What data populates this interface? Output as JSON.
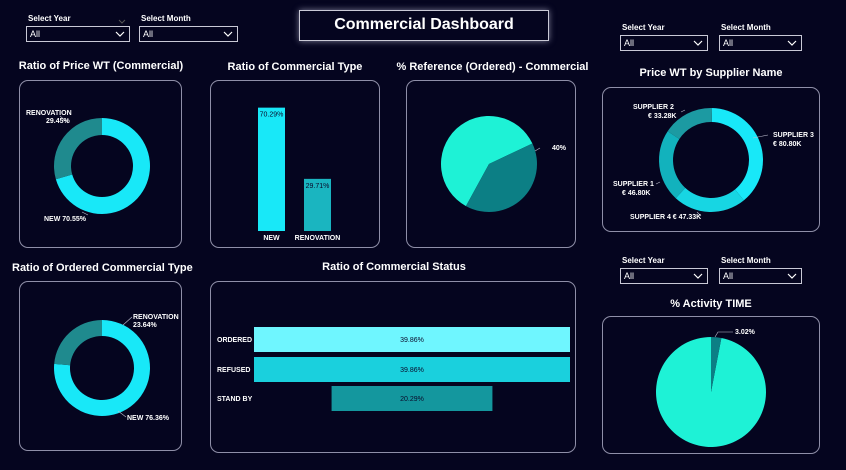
{
  "dashboard_title": "Commercial Dashboard",
  "colors": {
    "background": "#05051f",
    "cyan": "#18e8f8",
    "teal": "#1f8a8e",
    "mint": "#1ef2d6",
    "dark_teal": "#0c7f85"
  },
  "filters": [
    {
      "year_label": "Select Year",
      "year_value": "All",
      "month_label": "Select Month",
      "month_value": "All"
    },
    {
      "year_label": "Select Year",
      "year_value": "All",
      "month_label": "Select Month",
      "month_value": "All"
    },
    {
      "year_label": "Select Year",
      "year_value": "All",
      "month_label": "Select Month",
      "month_value": "All"
    }
  ],
  "chart_data": [
    {
      "type": "pie",
      "title": "Ratio of Price WT (Commercial)",
      "donut": true,
      "slices": [
        {
          "label": "NEW",
          "value": 70.55,
          "display": "NEW 70.55%"
        },
        {
          "label": "RENOVATION",
          "value": 29.45,
          "display": "29.45%"
        }
      ]
    },
    {
      "type": "bar",
      "title": "Ratio of Commercial Type",
      "categories": [
        "NEW",
        "RENOVATION"
      ],
      "values": [
        70.29,
        29.71
      ],
      "labels": [
        "70.29%",
        "29.71%"
      ]
    },
    {
      "type": "pie",
      "title": "% Reference (Ordered) - Commercial",
      "slices": [
        {
          "label": "",
          "value": 60,
          "display": ""
        },
        {
          "label": "",
          "value": 40,
          "display": "40%"
        }
      ]
    },
    {
      "type": "pie",
      "title": "Price WT by Supplier Name",
      "donut": true,
      "slices": [
        {
          "label": "SUPPLIER 3",
          "value": 80.8,
          "display": "€ 80.80K"
        },
        {
          "label": "SUPPLIER 4",
          "value": 47.33,
          "display": "€ 47.33K"
        },
        {
          "label": "SUPPLIER 1",
          "value": 46.8,
          "display": "€ 46.80K"
        },
        {
          "label": "SUPPLIER 2",
          "value": 33.28,
          "display": "€ 33.28K"
        }
      ]
    },
    {
      "type": "pie",
      "title": "Ratio of Ordered Commercial Type",
      "donut": true,
      "slices": [
        {
          "label": "NEW",
          "value": 76.36,
          "display": "NEW 76.36%"
        },
        {
          "label": "RENOVATION",
          "value": 23.64,
          "display": "23.64%"
        }
      ]
    },
    {
      "type": "bar",
      "title": "Ratio of Commercial Status",
      "orientation": "horizontal",
      "categories": [
        "ORDERED",
        "REFUSED",
        "STAND BY"
      ],
      "values": [
        39.86,
        39.86,
        20.29
      ],
      "labels": [
        "39.86%",
        "39.86%",
        "20.29%"
      ]
    },
    {
      "type": "pie",
      "title": "% Activity TIME",
      "slices": [
        {
          "label": "",
          "value": 96.98,
          "display": ""
        },
        {
          "label": "",
          "value": 3.02,
          "display": "3.02%"
        }
      ]
    }
  ]
}
